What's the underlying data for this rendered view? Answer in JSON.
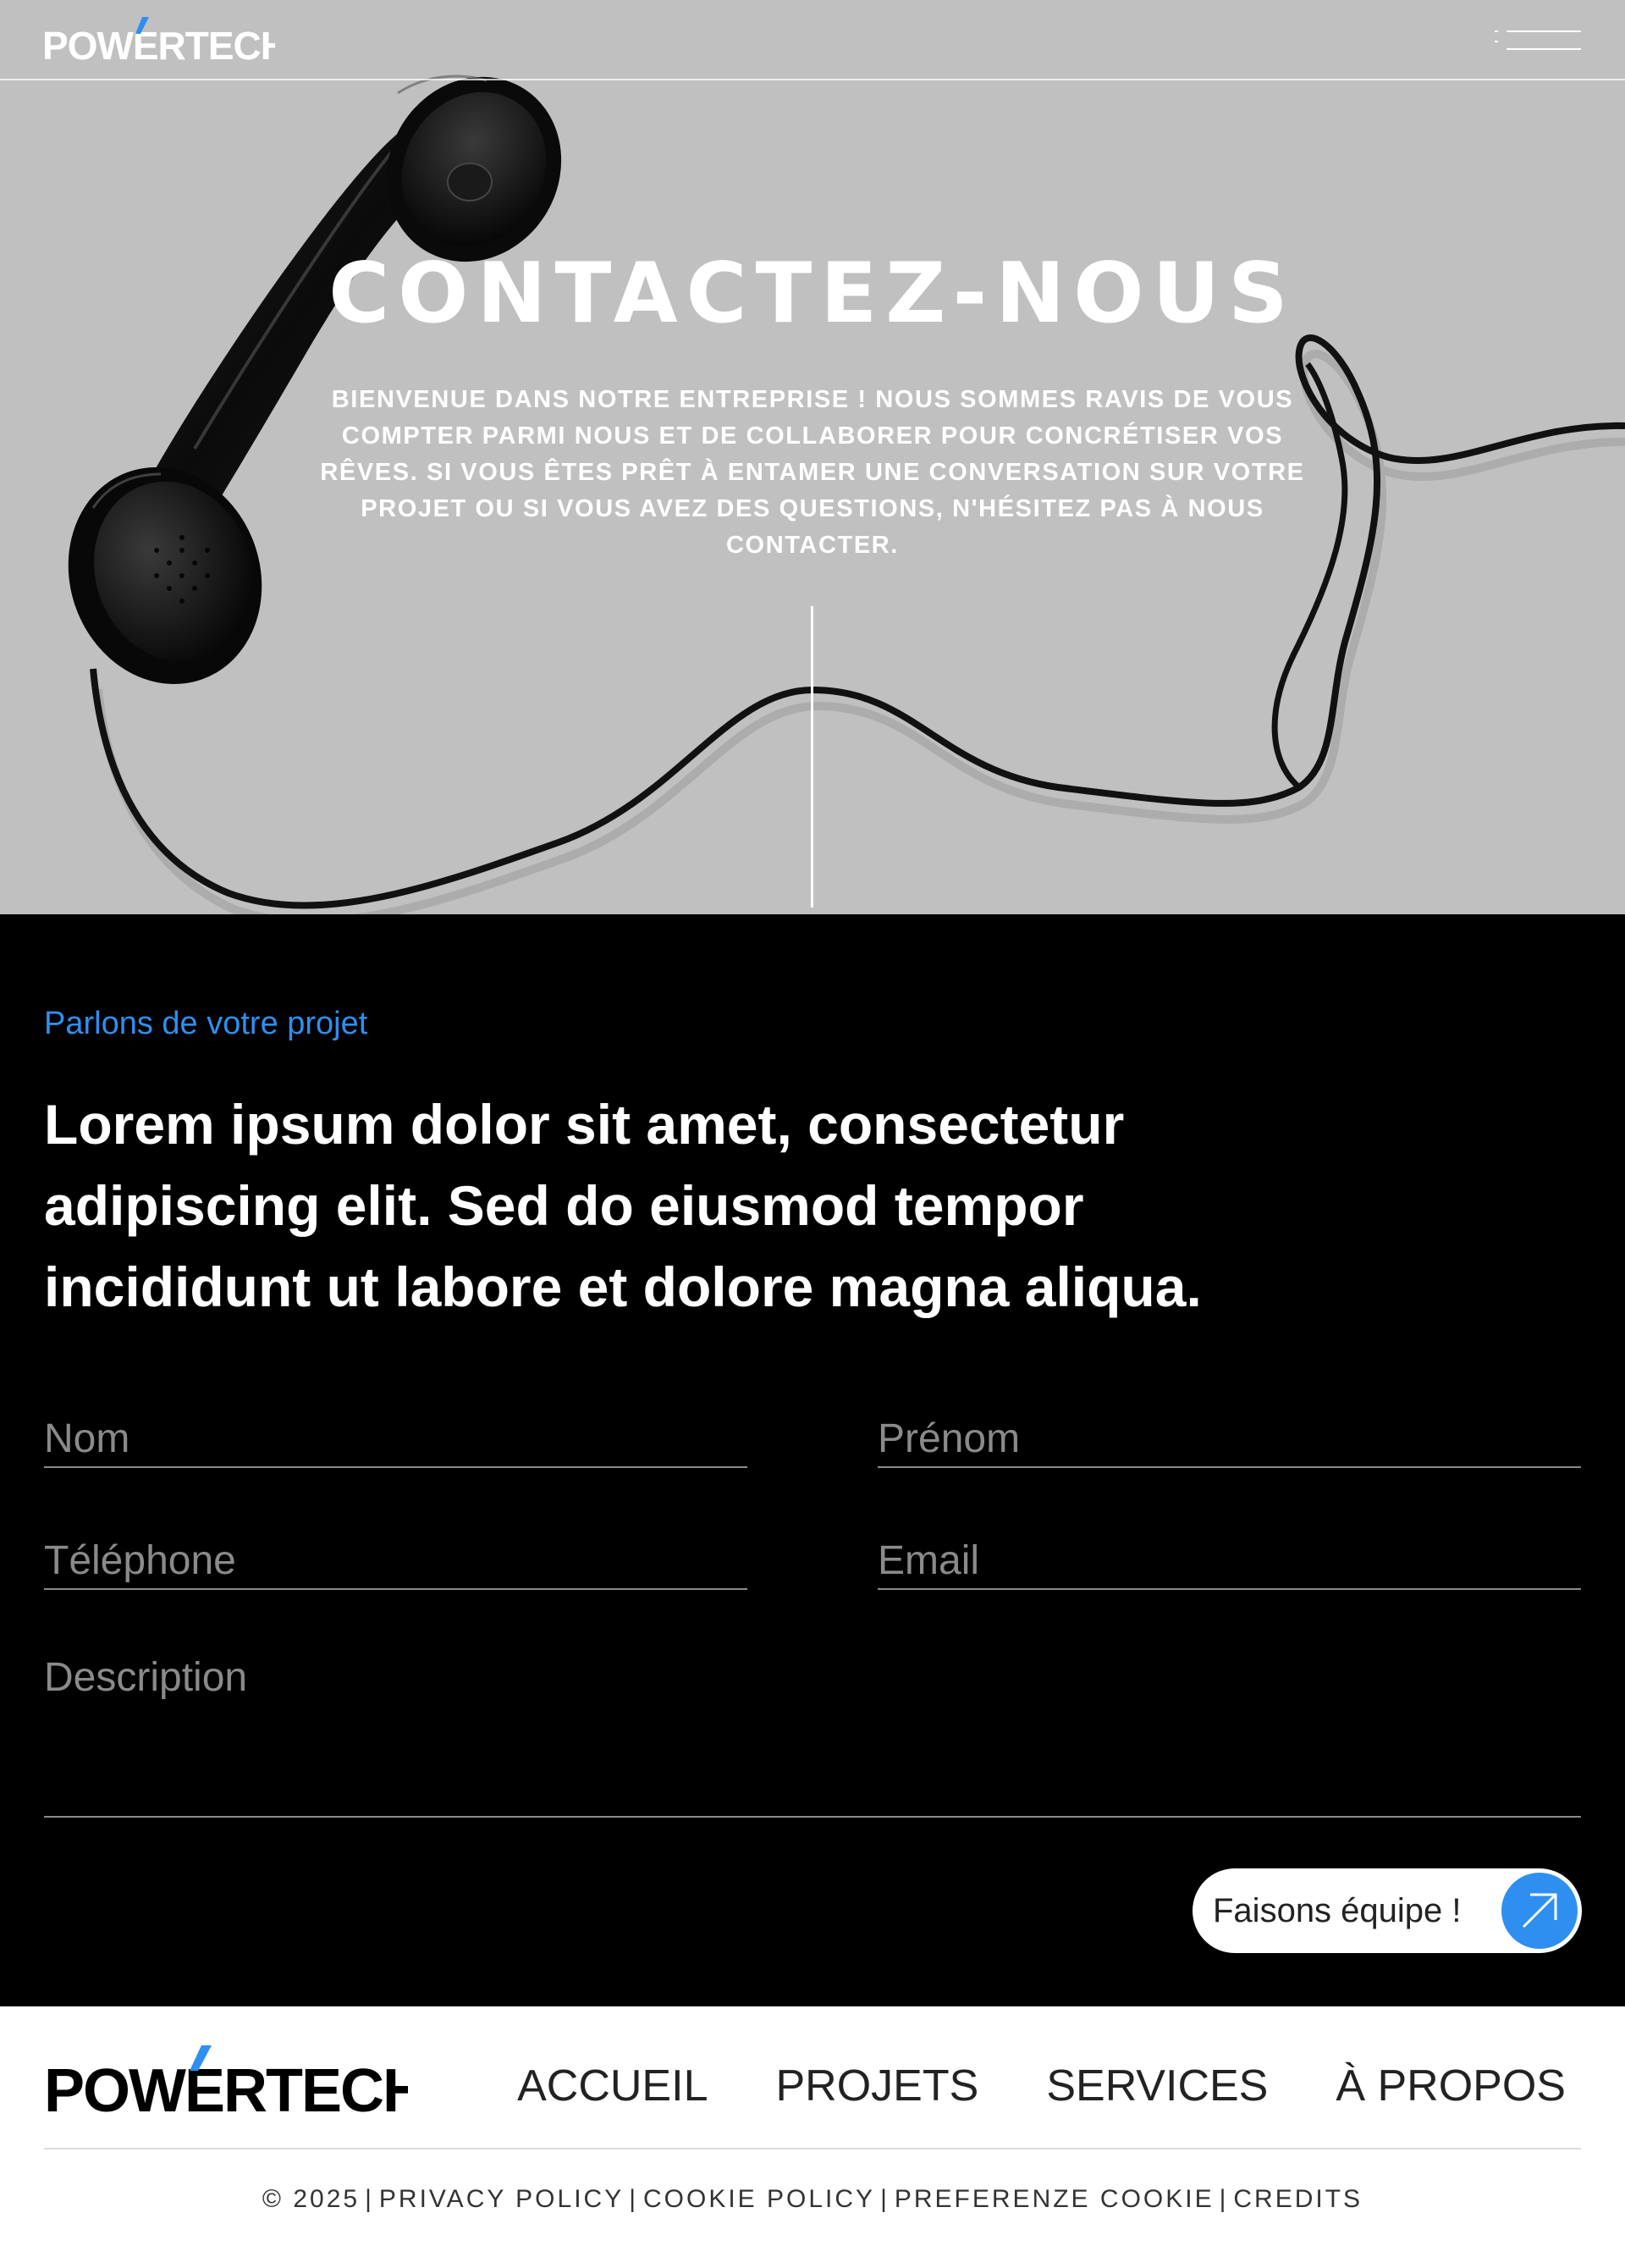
{
  "brand": {
    "name": "POWERTECH",
    "accent": "#2e8ff0"
  },
  "hero": {
    "title": "CONTACTEZ-NOUS",
    "text": "BIENVENUE DANS NOTRE ENTREPRISE ! NOUS SOMMES RAVIS DE VOUS COMPTER PARMI NOUS ET DE COLLABORER POUR CONCRÉTISER VOS RÊVES. SI VOUS ÊTES PRÊT À ENTAMER UNE CONVERSATION SUR VOTRE PROJET OU SI VOUS AVEZ DES QUESTIONS, N'HÉSITEZ PAS À NOUS CONTACTER.",
    "background_color": "#c0c0c0",
    "image_icon": "telephone-handset-icon"
  },
  "header": {
    "menu_icon": "hamburger-menu-icon"
  },
  "contact": {
    "kicker": "Parlons de votre projet",
    "heading": "Lorem ipsum dolor sit amet, consectetur adipiscing elit. Sed do eiusmod tempor incididunt ut labore et dolore magna aliqua.",
    "fields": {
      "nom": {
        "placeholder": "Nom",
        "value": ""
      },
      "prenom": {
        "placeholder": "Prénom",
        "value": ""
      },
      "telephone": {
        "placeholder": "Téléphone",
        "value": ""
      },
      "email": {
        "placeholder": "Email",
        "value": ""
      },
      "description": {
        "placeholder": "Description",
        "value": ""
      }
    },
    "submit": {
      "label": "Faisons équipe !",
      "icon": "arrow-up-right-icon"
    }
  },
  "footer": {
    "nav": [
      "ACCUEIL",
      "PROJETS",
      "SERVICES",
      "À PROPOS"
    ],
    "legal": {
      "copyright": "© 2025",
      "privacy": "PRIVACY POLICY",
      "cookie": "COOKIE POLICY",
      "preferences": "PREFERENZE COOKIE",
      "credits": "CREDITS"
    }
  }
}
